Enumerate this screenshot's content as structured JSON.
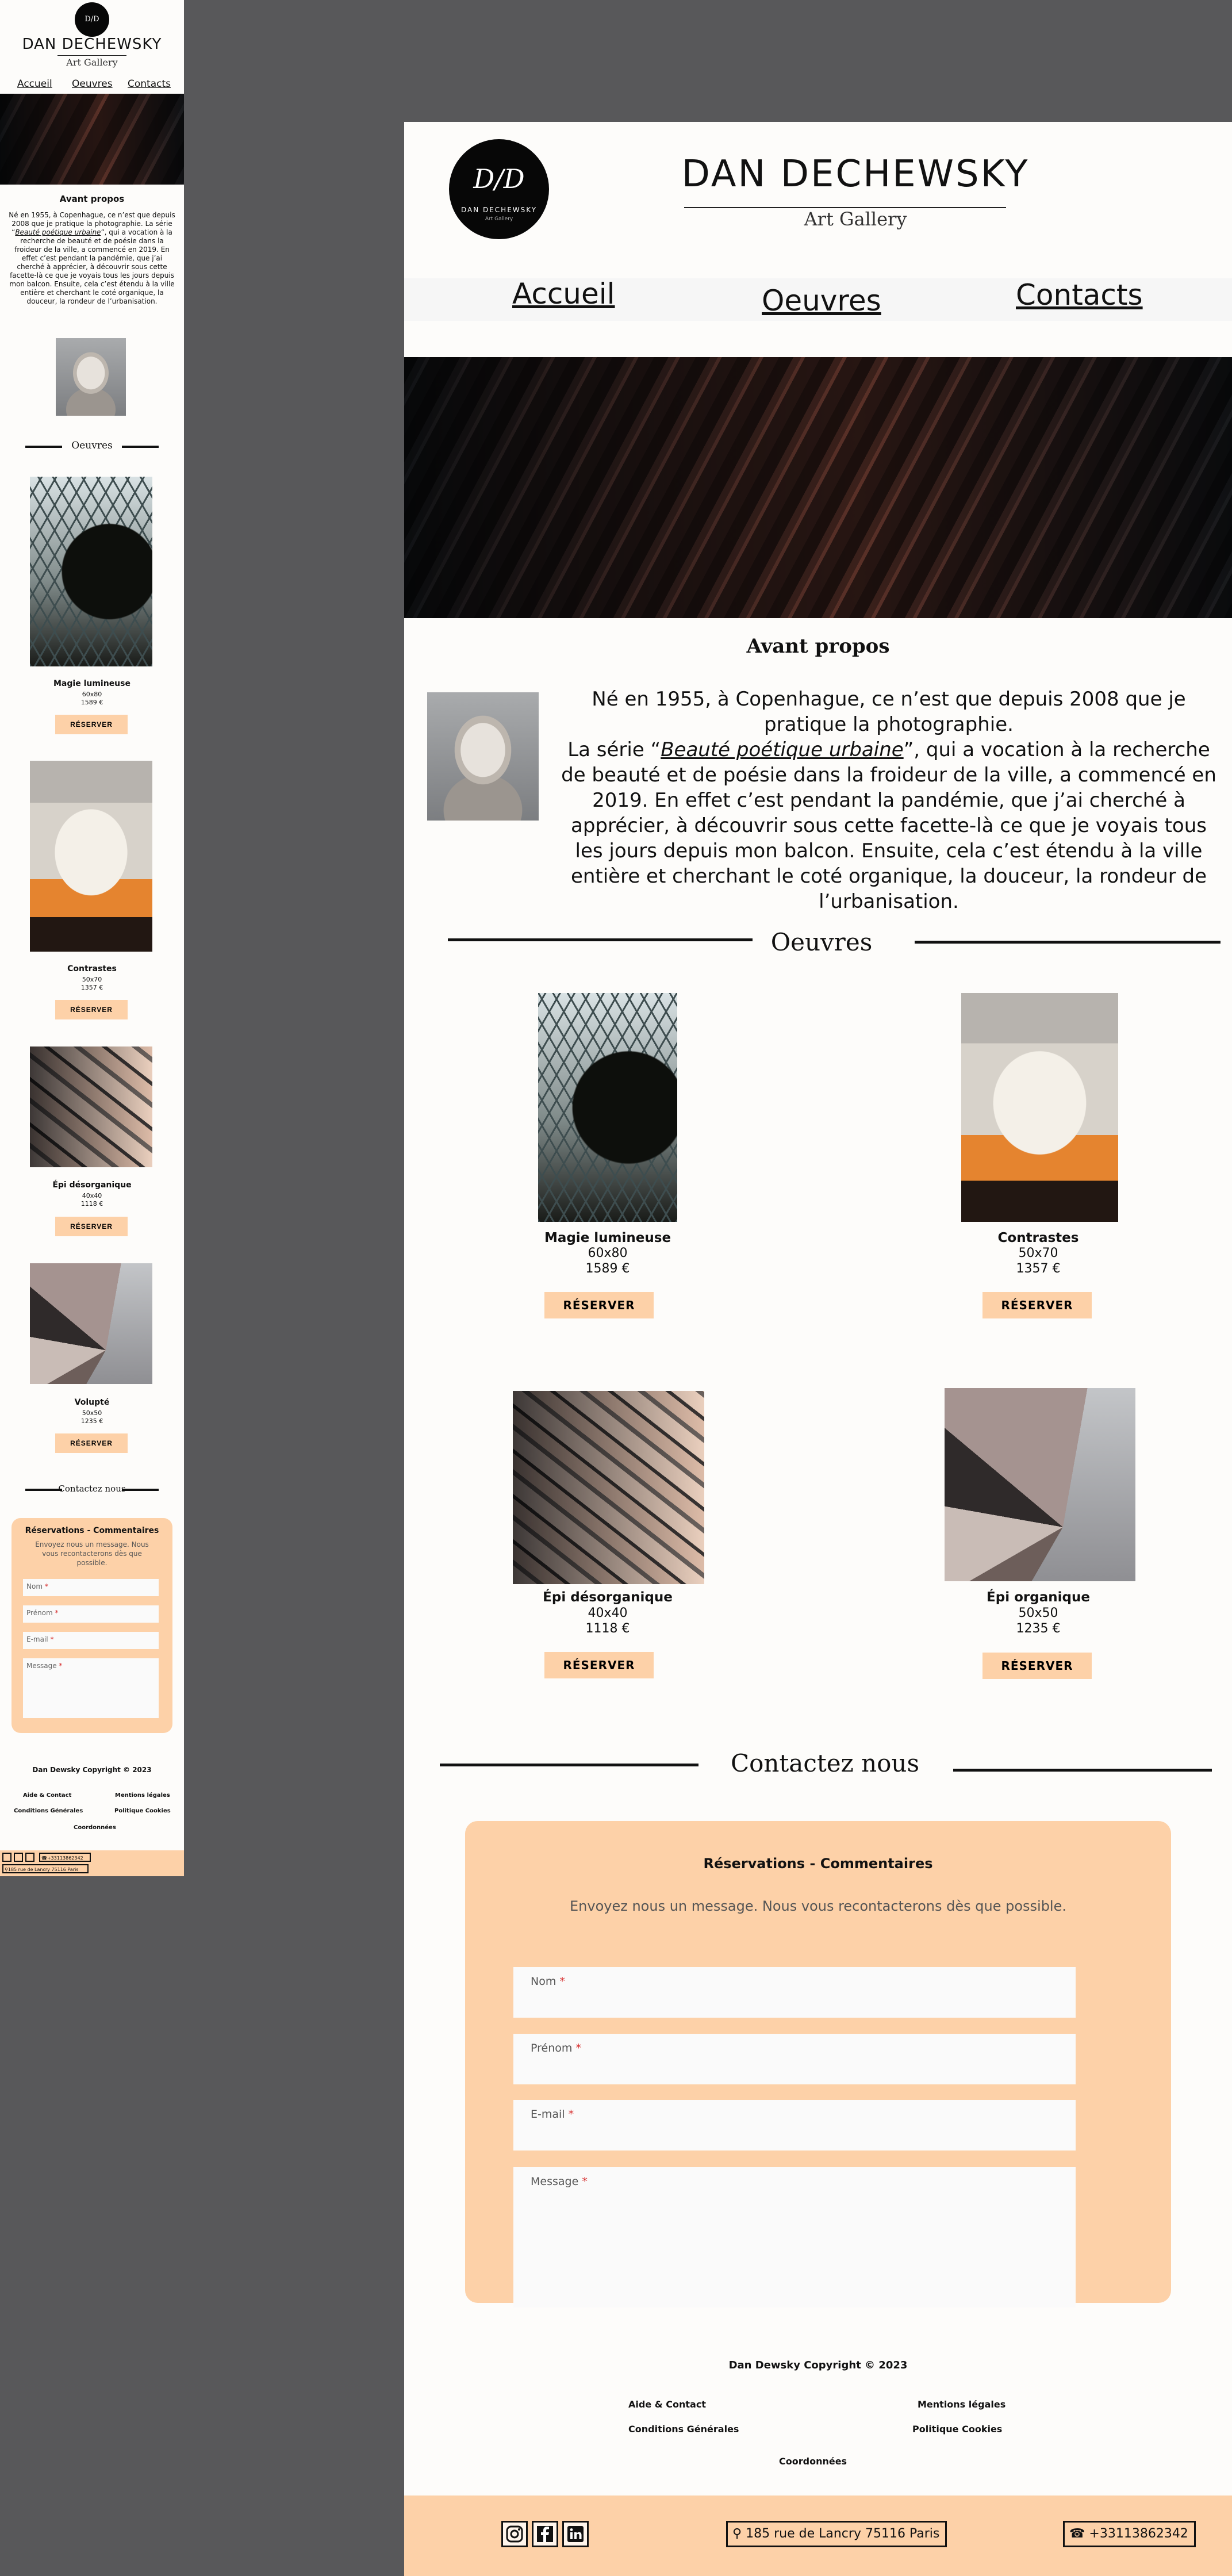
{
  "brand": {
    "name": "DAN DECHEWSKY",
    "subtitle": "Art Gallery",
    "logo_monogram": "D/D",
    "logo_name": "DAN DECHEWSKY",
    "logo_sub": "Art Gallery"
  },
  "nav": {
    "home": "Accueil",
    "works": "Oeuvres",
    "contacts": "Contacts"
  },
  "about": {
    "heading": "Avant propos",
    "line1": "Né en 1955, à Copenhague, ce n’est que depuis 2008 que je pratique la photographie.",
    "line2_prefix": "La série “",
    "series_name": "Beauté poétique urbaine",
    "line2_suffix": "”, qui a vocation à la recherche de beauté et de poésie dans la froideur de la ville, a commencé en 2019. En effet c’est pendant la pandémie, que j’ai cherché à apprécier, à découvrir sous cette facette-là ce que je voyais tous les jours depuis mon balcon. Ensuite, cela c’est étendu à la ville entière et cherchant le coté organique, la douceur, la rondeur de l’urbanisation."
  },
  "works_heading": "Oeuvres",
  "reserve_label": "RÉSERVER",
  "artworks": [
    {
      "name": "Magie lumineuse",
      "size": "60x80",
      "price": "1589 €"
    },
    {
      "name": "Contrastes",
      "size": "50x70",
      "price": "1357 €"
    },
    {
      "name": "Épi désorganique",
      "size": "40x40",
      "price": "1118 €"
    },
    {
      "name": "Épi organique",
      "size": "50x50",
      "price": "1235 €"
    }
  ],
  "mobile_artworks": [
    {
      "name": "Magie lumineuse",
      "size": "60x80",
      "price": "1589 €"
    },
    {
      "name": "Contrastes",
      "size": "50x70",
      "price": "1357 €"
    },
    {
      "name": "Épi désorganique",
      "size": "40x40",
      "price": "1118 €"
    },
    {
      "name": "Volupté",
      "size": "50x50",
      "price": "1235 €"
    }
  ],
  "contact": {
    "heading": "Contactez nous",
    "form_title": "Réservations - Commentaires",
    "form_intro": "Envoyez nous un message. Nous vous recontacterons dès que possible.",
    "nom": "Nom",
    "prenom": "Prénom",
    "email": "E-mail",
    "message": "Message",
    "required": "*"
  },
  "footer": {
    "copyright": "Dan Dewsky Copyright © 2023",
    "aide": "Aide & Contact",
    "mentions": "Mentions légales",
    "conditions": "Conditions Générales",
    "cookies": "Politique Cookies",
    "coordonnees": "Coordonnées",
    "address": "185 rue de Lancry 75116 Paris",
    "phone": "+33113862342"
  },
  "colors": {
    "accent": "#fdd1a8",
    "page_bg": "#fdfcfa",
    "backdrop": "#58585a",
    "text": "#111111"
  }
}
